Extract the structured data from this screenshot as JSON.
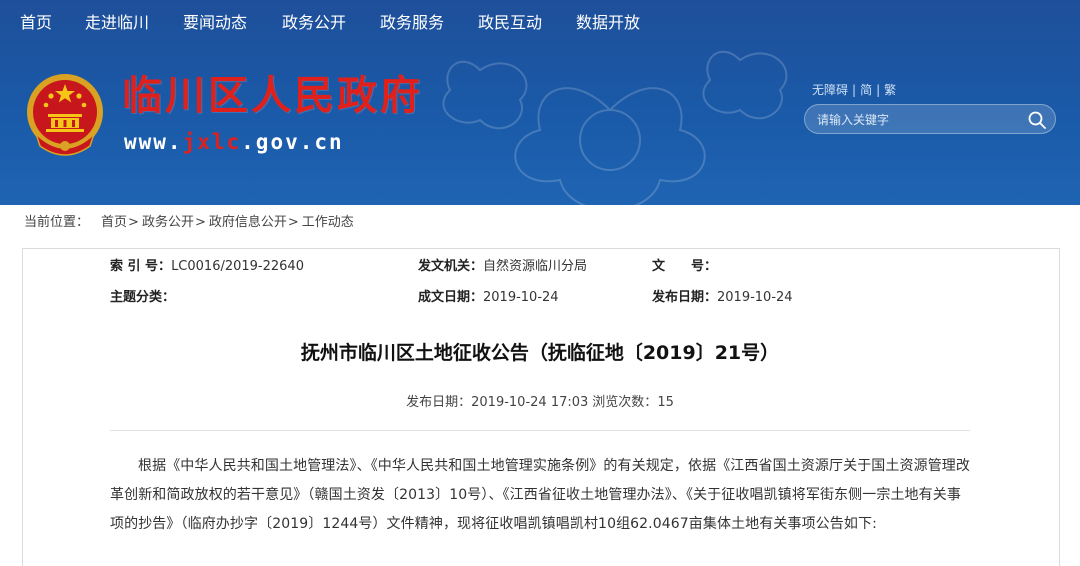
{
  "nav": {
    "items": [
      "首页",
      "走进临川",
      "要闻动态",
      "政务公开",
      "政务服务",
      "政民互动",
      "数据开放"
    ]
  },
  "header": {
    "title": "临川区人民政府",
    "url_prefix": "www.",
    "url_highlight": "jxlc",
    "url_suffix": ".gov.cn",
    "tools": [
      "无障碍",
      "简",
      "繁"
    ],
    "search_placeholder": "请输入关键字",
    "colors": {
      "band": "#1e4f9a",
      "title": "#e0201b"
    }
  },
  "breadcrumb": {
    "label": "当前位置：",
    "items": [
      "首页",
      "政务公开",
      "政府信息公开",
      "工作动态"
    ]
  },
  "meta": {
    "index_label": "索 引 号：",
    "index_value": "LC0016/2019-22640",
    "issuer_label": "发文机关：",
    "issuer_value": "自然资源临川分局",
    "docno_label": "文　　号：",
    "docno_value": "",
    "topic_label": "主题分类：",
    "topic_value": "",
    "created_label": "成文日期：",
    "created_value": "2019-10-24",
    "published_label": "发布日期：",
    "published_value": "2019-10-24"
  },
  "article": {
    "title": "抚州市临川区土地征收公告（抚临征地〔2019〕21号）",
    "pub_label": "发布日期：",
    "pub_datetime": "2019-10-24 17:03",
    "views_label": "浏览次数：",
    "views": "15",
    "body": "根据《中华人民共和国土地管理法》、《中华人民共和国土地管理实施条例》的有关规定，依据《江西省国土资源厅关于国土资源管理改革创新和简政放权的若干意见》（赣国土资发〔2013〕10号）、《江西省征收土地管理办法》、《关于征收唱凯镇将军街东侧一宗土地有关事项的抄告》（临府办抄字〔2019〕1244号）文件精神，现将征收唱凯镇唱凯村10组62.0467亩集体土地有关事项公告如下:"
  }
}
